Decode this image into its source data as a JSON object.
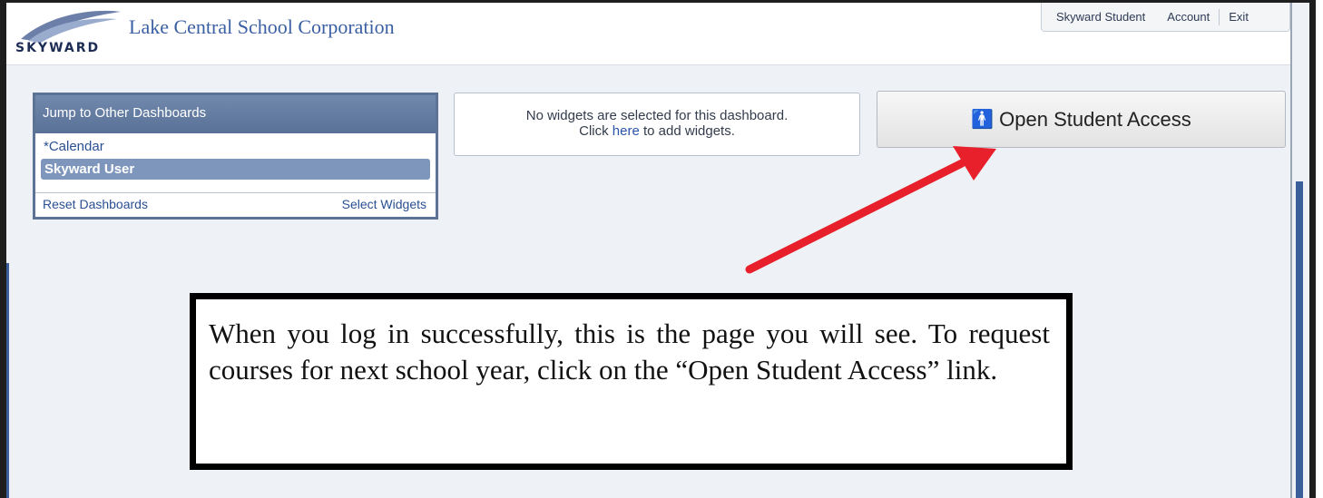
{
  "header": {
    "logo_text": "SKYWARD",
    "school_name": "Lake Central School Corporation"
  },
  "top_nav": {
    "student": "Skyward Student",
    "account": "Account",
    "exit": "Exit"
  },
  "dashboards": {
    "title": "Jump to Other Dashboards",
    "items": [
      {
        "label": "*Calendar",
        "selected": false
      },
      {
        "label": "Skyward User",
        "selected": true
      }
    ],
    "reset_label": "Reset Dashboards",
    "select_label": "Select Widgets"
  },
  "widgets": {
    "line1": "No widgets are selected for this dashboard.",
    "click": "Click",
    "here": "here",
    "suffix": "to add widgets."
  },
  "student_access": {
    "icon": "person-icon",
    "label": "Open Student Access"
  },
  "annotation": {
    "text": "When you log in successfully, this is the page you will see.  To request courses for next school year, click on the “Open Student Access” link."
  },
  "colors": {
    "accent": "#3b5fa3",
    "arrow": "#e8202b",
    "panel_header": "#5a7197"
  }
}
